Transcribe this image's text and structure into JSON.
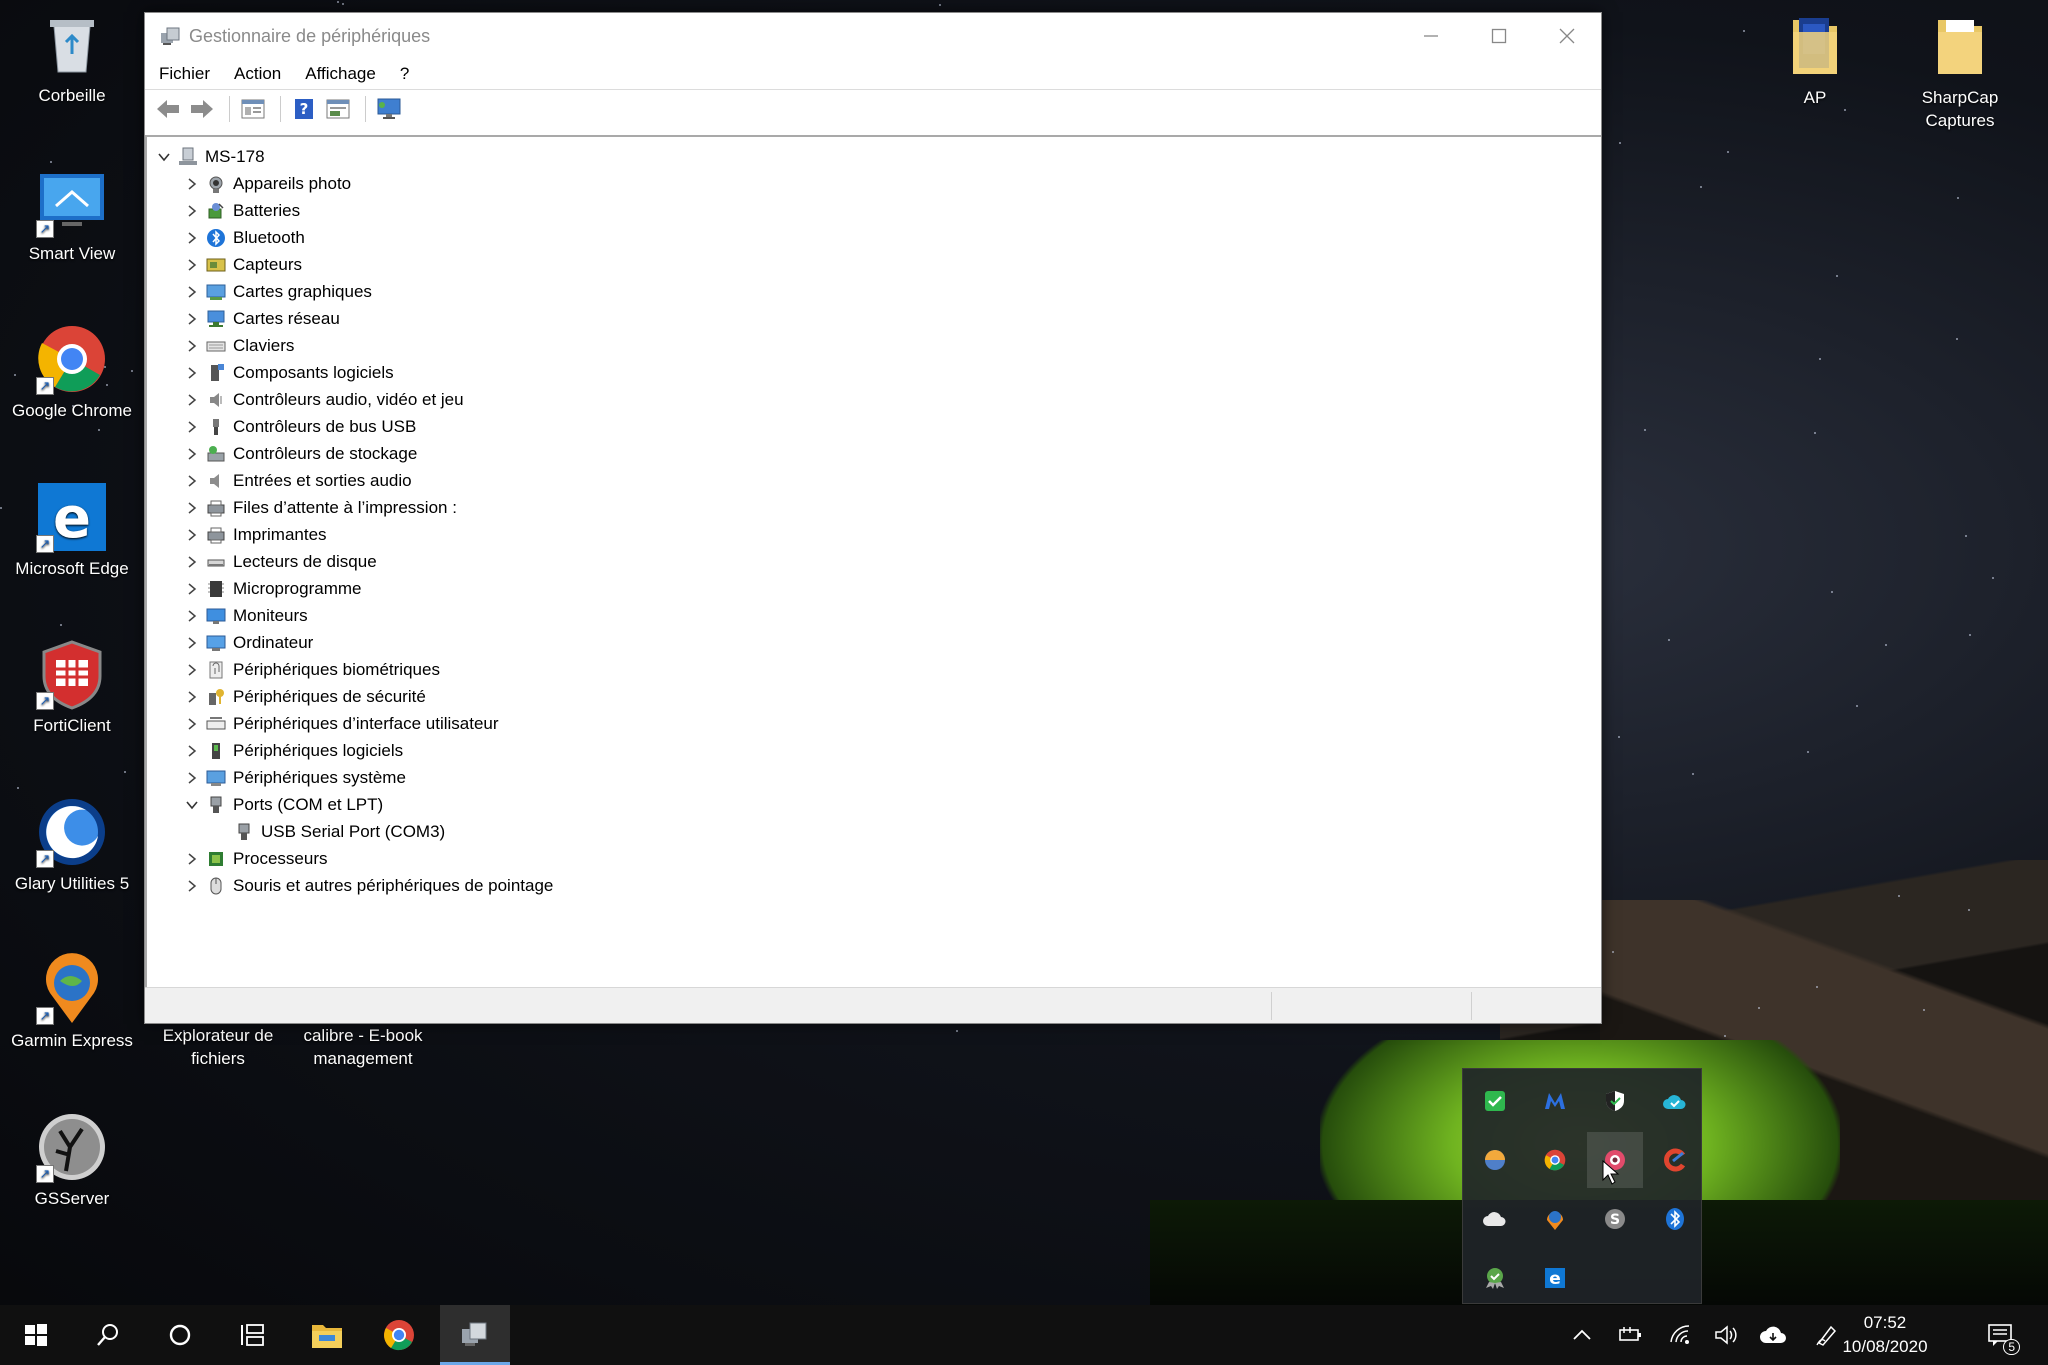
{
  "desktop": {
    "icons_left": [
      {
        "label": "Corbeille",
        "icon": "recycle-bin-icon"
      },
      {
        "label": "Smart View",
        "icon": "smart-view-icon"
      },
      {
        "label": "Google Chrome",
        "icon": "chrome-icon"
      },
      {
        "label": "Microsoft Edge",
        "icon": "edge-icon"
      },
      {
        "label": "FortiClient",
        "icon": "forticlient-icon"
      },
      {
        "label": "Glary Utilities 5",
        "icon": "glary-utilities-icon"
      },
      {
        "label": "Garmin Express",
        "icon": "garmin-express-icon"
      },
      {
        "label": "GSServer",
        "icon": "gsserver-icon"
      }
    ],
    "icons_row": [
      {
        "label": "Explorateur de fichiers",
        "icon": "file-explorer-icon"
      },
      {
        "label": "calibre - E-book management",
        "icon": "calibre-icon"
      }
    ],
    "icons_right": [
      {
        "label": "AP",
        "icon": "folder-icon"
      },
      {
        "label": "SharpCap Captures",
        "icon": "folder-icon"
      }
    ]
  },
  "window": {
    "title": "Gestionnaire de périphériques",
    "menu": [
      "Fichier",
      "Action",
      "Affichage",
      "?"
    ],
    "toolbar_icons": [
      "back-arrow-icon",
      "forward-arrow-icon",
      "properties-icon",
      "help-icon",
      "view-icon",
      "monitor-icon"
    ],
    "tree": {
      "root": "MS-178",
      "nodes": [
        {
          "label": "Appareils photo",
          "icon": "camera-icon",
          "expanded": false
        },
        {
          "label": "Batteries",
          "icon": "battery-icon",
          "expanded": false
        },
        {
          "label": "Bluetooth",
          "icon": "bluetooth-icon",
          "expanded": false
        },
        {
          "label": "Capteurs",
          "icon": "sensor-icon",
          "expanded": false
        },
        {
          "label": "Cartes graphiques",
          "icon": "display-adapter-icon",
          "expanded": false
        },
        {
          "label": "Cartes réseau",
          "icon": "network-adapter-icon",
          "expanded": false
        },
        {
          "label": "Claviers",
          "icon": "keyboard-icon",
          "expanded": false
        },
        {
          "label": "Composants logiciels",
          "icon": "software-component-icon",
          "expanded": false
        },
        {
          "label": "Contrôleurs audio, vidéo et jeu",
          "icon": "audio-icon",
          "expanded": false
        },
        {
          "label": "Contrôleurs de bus USB",
          "icon": "usb-icon",
          "expanded": false
        },
        {
          "label": "Contrôleurs de stockage",
          "icon": "storage-icon",
          "expanded": false
        },
        {
          "label": "Entrées et sorties audio",
          "icon": "speaker-icon",
          "expanded": false
        },
        {
          "label": "Files d’attente à l’impression :",
          "icon": "print-queue-icon",
          "expanded": false
        },
        {
          "label": "Imprimantes",
          "icon": "printer-icon",
          "expanded": false
        },
        {
          "label": "Lecteurs de disque",
          "icon": "disk-drive-icon",
          "expanded": false
        },
        {
          "label": "Microprogramme",
          "icon": "firmware-icon",
          "expanded": false
        },
        {
          "label": "Moniteurs",
          "icon": "monitor-icon",
          "expanded": false
        },
        {
          "label": "Ordinateur",
          "icon": "computer-icon",
          "expanded": false
        },
        {
          "label": "Périphériques biométriques",
          "icon": "fingerprint-icon",
          "expanded": false
        },
        {
          "label": "Périphériques de sécurité",
          "icon": "security-device-icon",
          "expanded": false
        },
        {
          "label": "Périphériques d’interface utilisateur",
          "icon": "hid-icon",
          "expanded": false
        },
        {
          "label": "Périphériques logiciels",
          "icon": "software-device-icon",
          "expanded": false
        },
        {
          "label": "Périphériques système",
          "icon": "system-device-icon",
          "expanded": false
        },
        {
          "label": "Ports (COM et LPT)",
          "icon": "port-icon",
          "expanded": true,
          "children": [
            {
              "label": "USB Serial Port (COM3)",
              "icon": "port-icon"
            }
          ]
        },
        {
          "label": "Processeurs",
          "icon": "processor-icon",
          "expanded": false
        },
        {
          "label": "Souris et autres périphériques de pointage",
          "icon": "mouse-icon",
          "expanded": false
        }
      ]
    }
  },
  "tray_overflow": [
    "security-check-icon",
    "malwarebytes-icon",
    "defender-shield-icon",
    "cloud-check-icon",
    "balloon-icon",
    "chrome-icon",
    "flower-app-icon",
    "ccleaner-icon",
    "onedrive-icon",
    "garmin-icon",
    "skype-icon",
    "bluetooth-icon",
    "ribbon-check-icon",
    "edge-icon"
  ],
  "taskbar": {
    "left_icons": [
      "start-icon",
      "search-icon",
      "cortana-icon",
      "task-view-icon",
      "file-explorer-icon",
      "chrome-icon",
      "device-manager-icon"
    ],
    "tray_icons": [
      "chevron-up-icon",
      "power-icon",
      "wifi-icon",
      "volume-icon",
      "cloud-icon",
      "pen-icon"
    ],
    "time": "07:52",
    "date": "10/08/2020",
    "notification_count": "5"
  }
}
